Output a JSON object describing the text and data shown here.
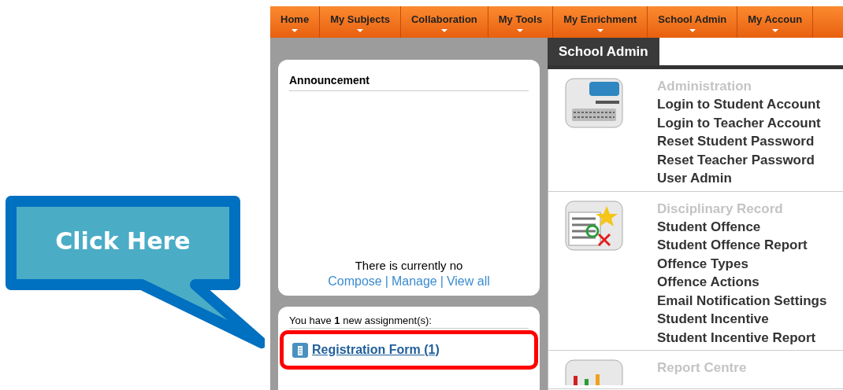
{
  "callout": {
    "text": "Click Here"
  },
  "nav": [
    {
      "label": "Home"
    },
    {
      "label": "My Subjects"
    },
    {
      "label": "Collaboration"
    },
    {
      "label": "My Tools"
    },
    {
      "label": "My Enrichment"
    },
    {
      "label": "School Admin"
    },
    {
      "label": "My Accoun"
    }
  ],
  "announcement": {
    "title": "Announcement",
    "message": "There is currently no",
    "links": [
      "Compose",
      "Manage",
      "View all"
    ],
    "separator": "|"
  },
  "assignments": {
    "heading": "You have **1** new assignment(s):",
    "items": [
      {
        "label": "Registration Form (1)",
        "highlighted": true
      }
    ]
  },
  "panel": {
    "tab": "School Admin",
    "sections": [
      {
        "kind": "computer",
        "title": "Administration",
        "links": [
          "Login to Student Account",
          "Login to Teacher Account",
          "Reset Student Password",
          "Reset Teacher Password",
          "User Admin"
        ]
      },
      {
        "kind": "discipline",
        "title": "Disciplinary Record",
        "links": [
          "Student Offence",
          "Student Offence Report",
          "Offence Types",
          "Offence Actions",
          "Email Notification Settings",
          "Student Incentive",
          "Student Incentive Report"
        ]
      },
      {
        "kind": "chart",
        "title": "Report Centre"
      }
    ]
  }
}
